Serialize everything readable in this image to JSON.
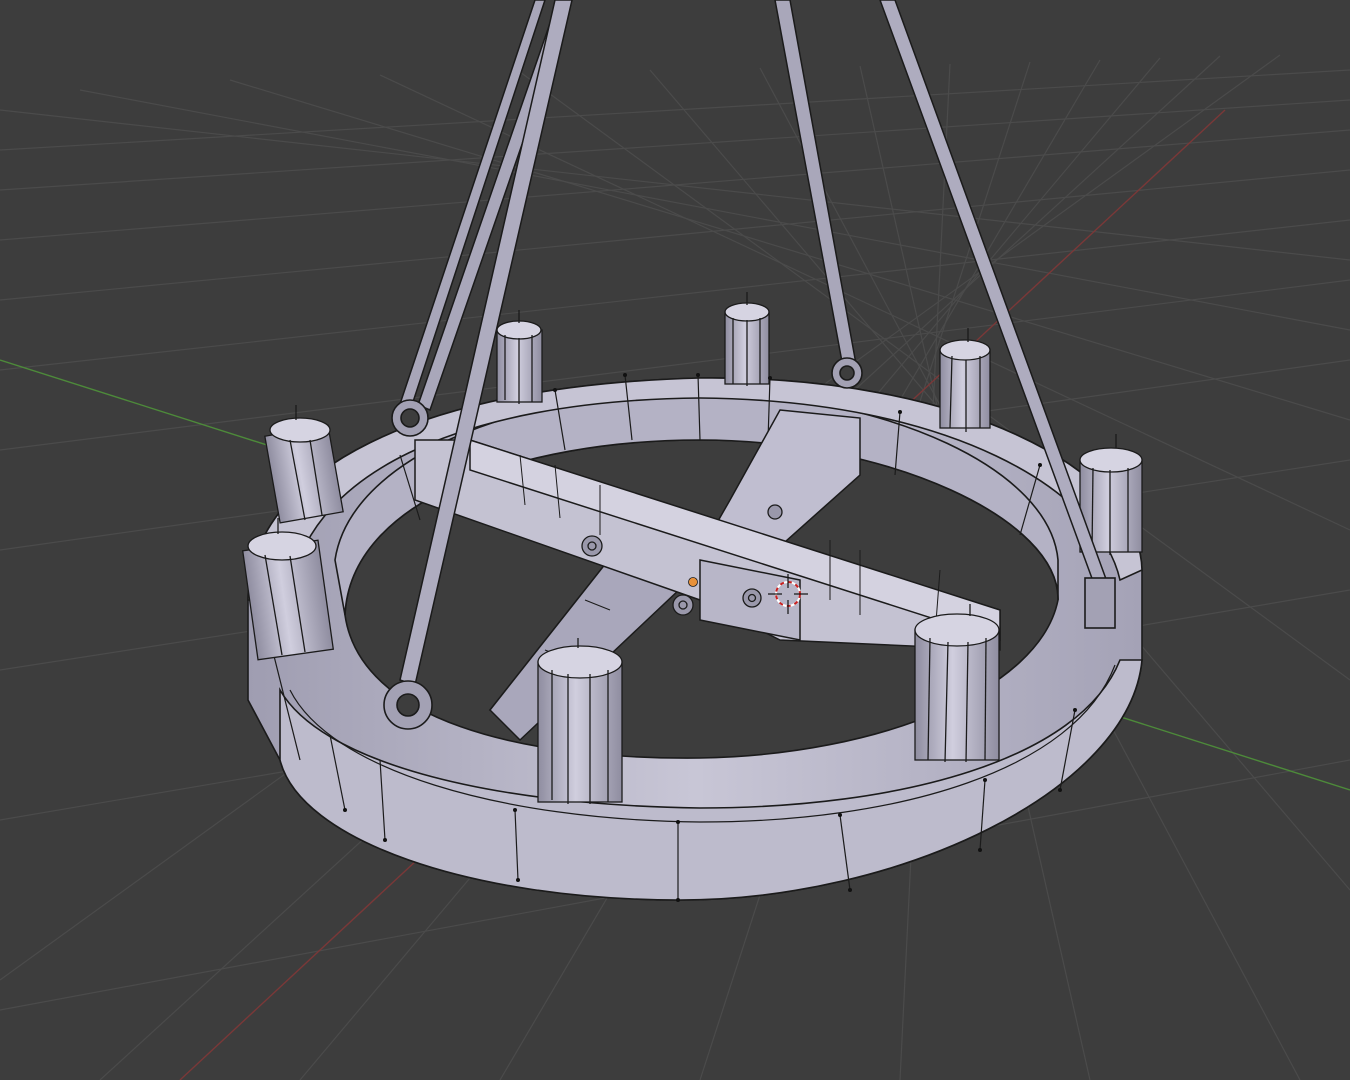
{
  "viewport": {
    "background": "#3d3d3d",
    "grid_color": "#4a4a4a",
    "x_axis_color": "#8a3a3a",
    "y_axis_color": "#4f8a3a"
  },
  "model": {
    "name": "chandelier",
    "face_color": "#b9b7c9",
    "shade_color": "#8f8da0",
    "wire_color": "#1b1b1b",
    "candle_count": 8,
    "chain_count": 4
  },
  "overlays": {
    "origin_color": "#e8913a",
    "cursor_color": "#c82020"
  }
}
